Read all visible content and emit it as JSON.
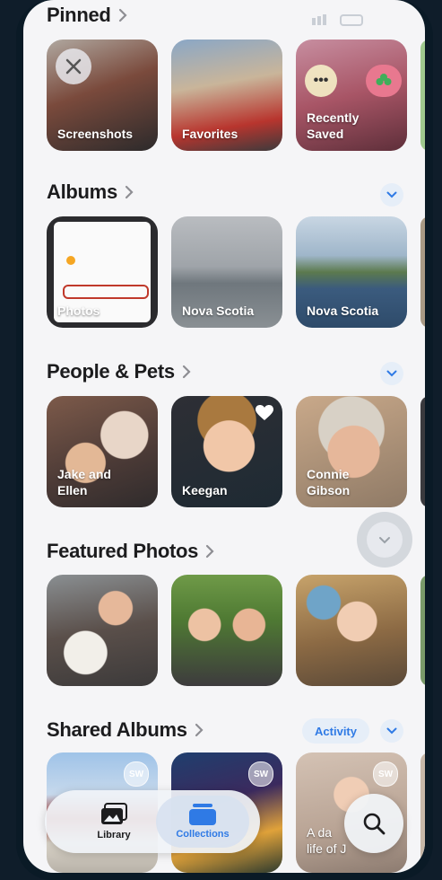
{
  "pinned": {
    "title": "Pinned",
    "items": [
      {
        "label": "Screenshots"
      },
      {
        "label": "Favorites"
      },
      {
        "label": "Recently\nSaved"
      }
    ]
  },
  "albums": {
    "title": "Albums",
    "items": [
      {
        "label": "Photos"
      },
      {
        "label": "Nova Scotia"
      },
      {
        "label": "Nova Scotia"
      }
    ]
  },
  "people": {
    "title": "People & Pets",
    "items": [
      {
        "label": "Jake and\nEllen"
      },
      {
        "label": "Keegan"
      },
      {
        "label": "Connie\nGibson"
      }
    ]
  },
  "featured": {
    "title": "Featured Photos"
  },
  "shared": {
    "title": "Shared Albums",
    "activity_label": "Activity",
    "items": [
      {
        "badge": "SW"
      },
      {
        "badge": "SW"
      },
      {
        "badge": "SW",
        "label": "A da\nlife of J"
      }
    ]
  },
  "tabbar": {
    "library_label": "Library",
    "collections_label": "Collections"
  },
  "colors": {
    "accent": "#2f7ae5",
    "background": "#f5f5f7"
  }
}
